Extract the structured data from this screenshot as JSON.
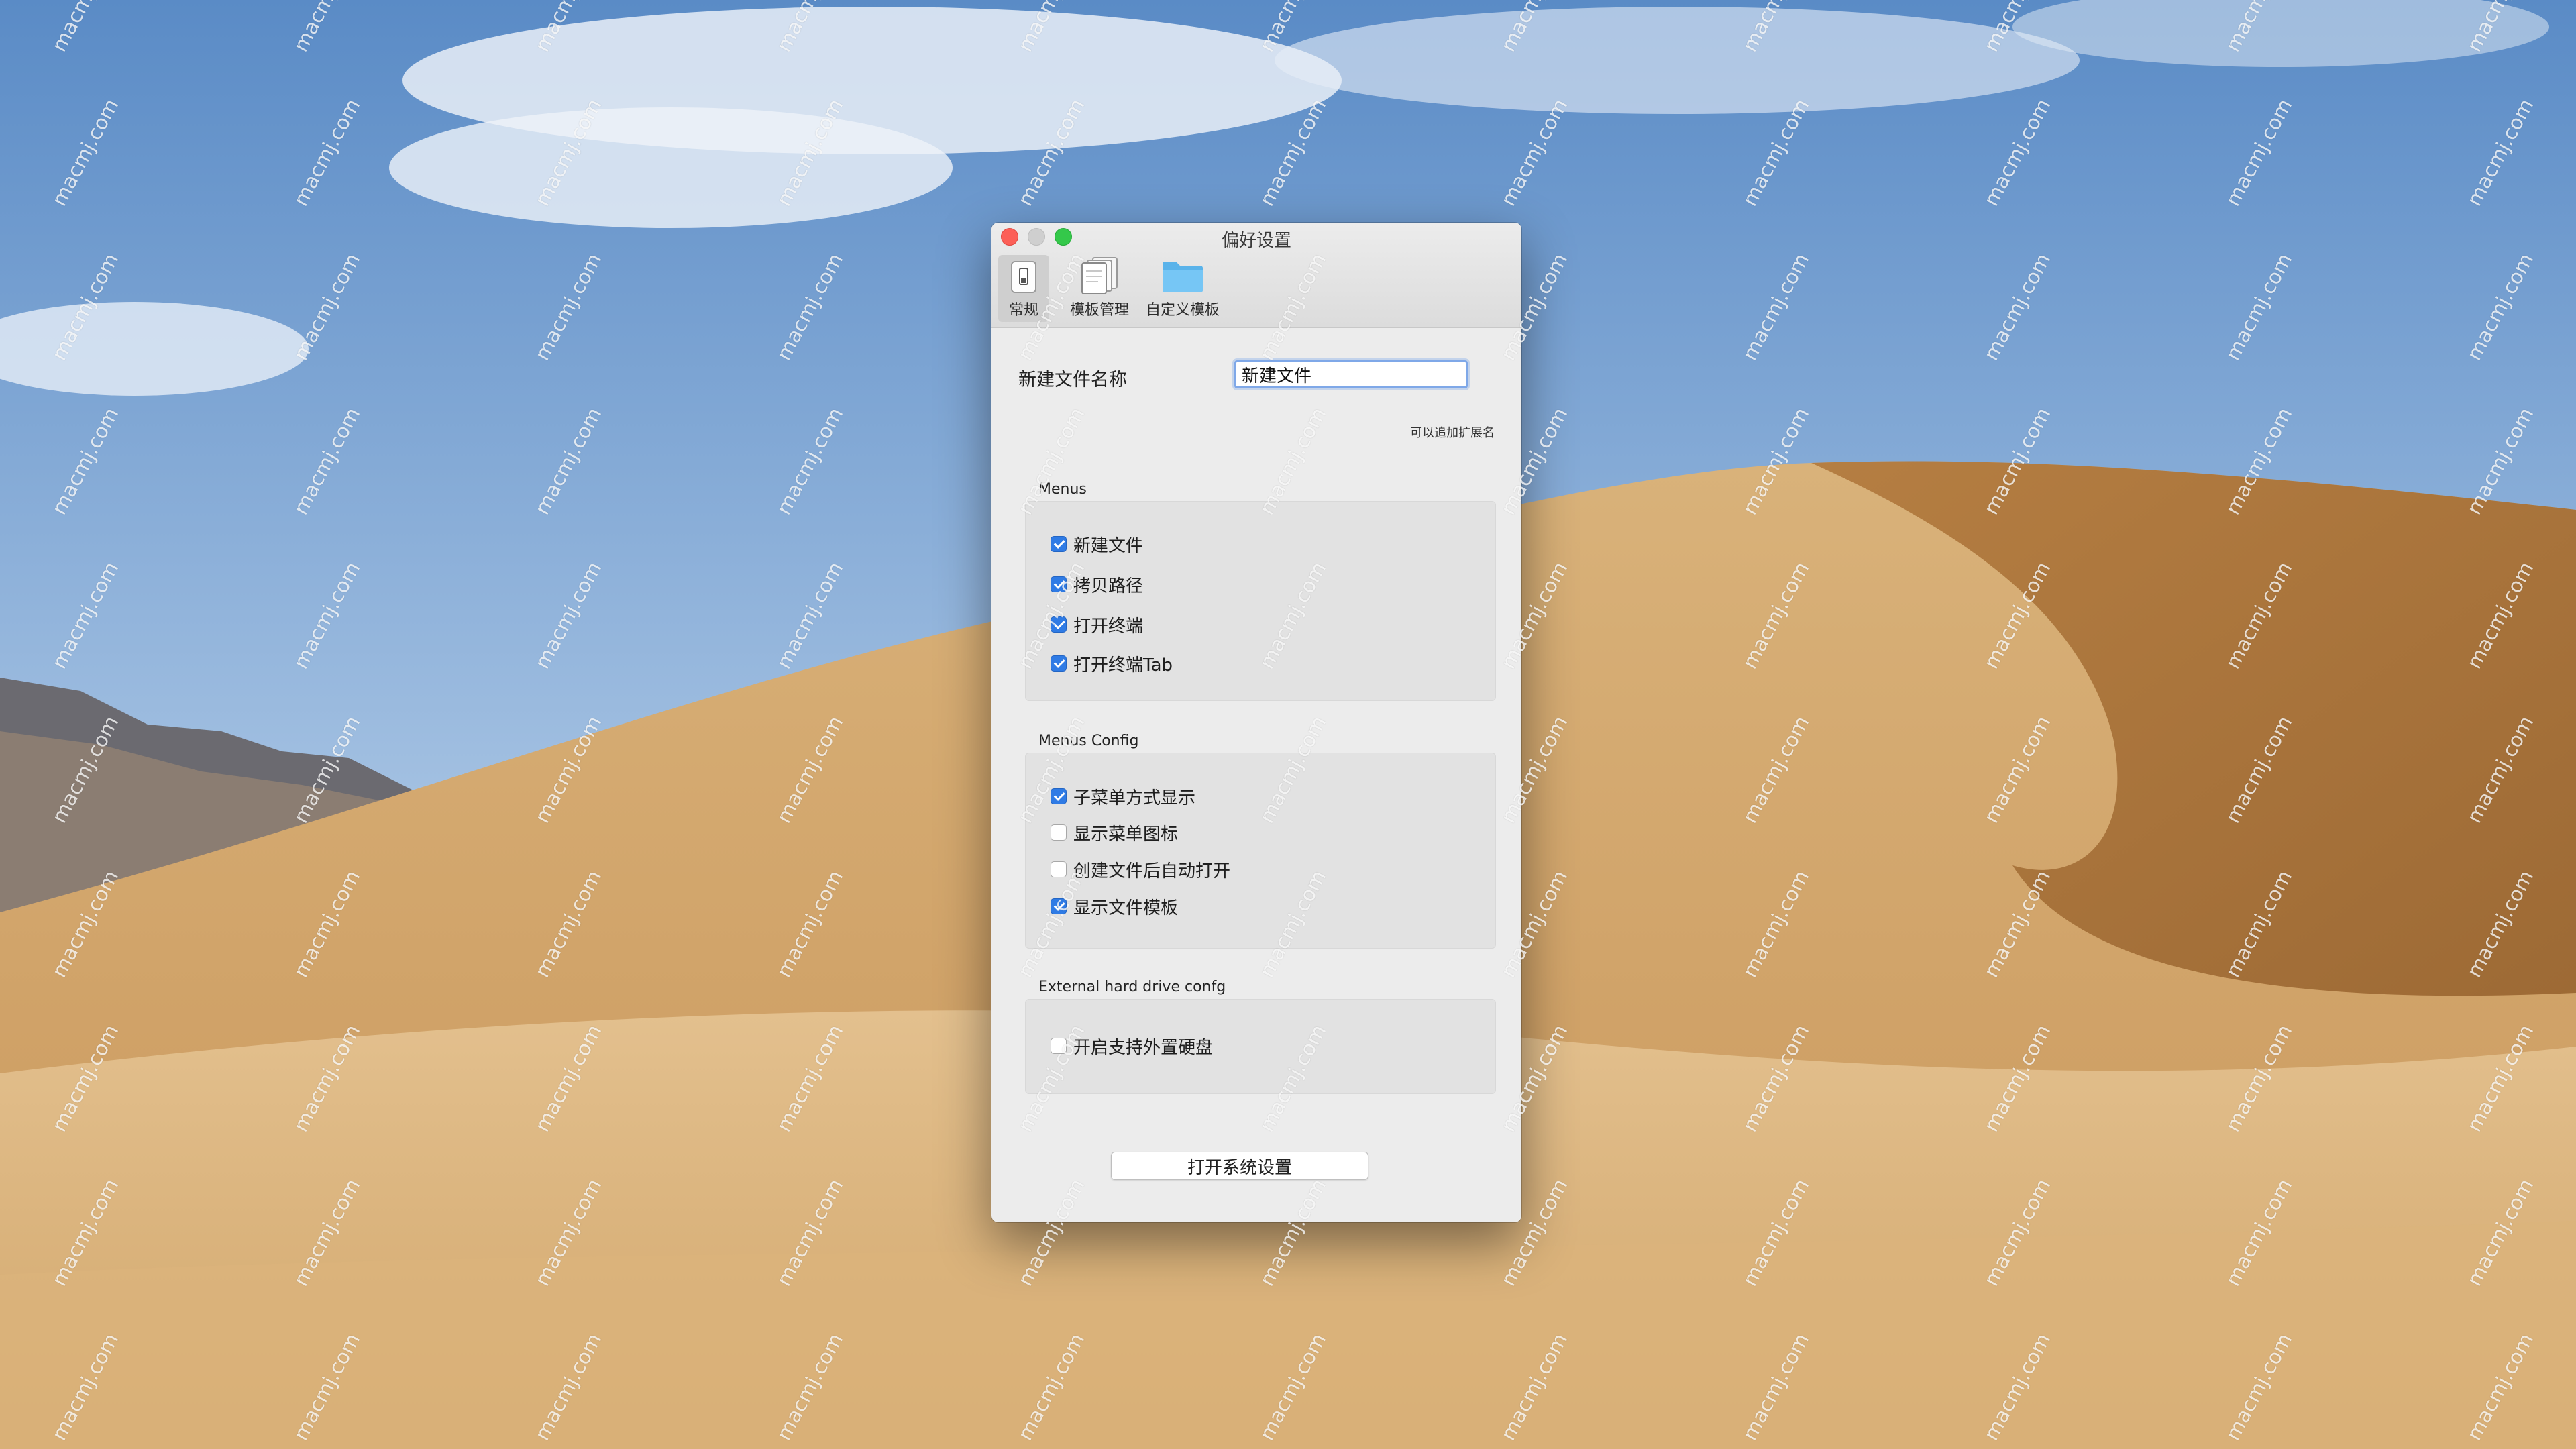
{
  "window": {
    "title": "偏好设置"
  },
  "toolbar": {
    "items": [
      {
        "label": "常规",
        "icon": "switch-icon"
      },
      {
        "label": "模板管理",
        "icon": "documents-icon"
      },
      {
        "label": "自定义模板",
        "icon": "folder-icon"
      }
    ]
  },
  "general": {
    "name_label": "新建文件名称",
    "name_value": "新建文件",
    "name_hint": "可以追加扩展名"
  },
  "menus": {
    "title": "Menus",
    "items": [
      {
        "label": "新建文件",
        "checked": true
      },
      {
        "label": "拷贝路径",
        "checked": true
      },
      {
        "label": "打开终端",
        "checked": true
      },
      {
        "label": "打开终端Tab",
        "checked": true
      }
    ]
  },
  "menus_config": {
    "title": "Menus Config",
    "items": [
      {
        "label": "子菜单方式显示",
        "checked": true
      },
      {
        "label": "显示菜单图标",
        "checked": false
      },
      {
        "label": "创建文件后自动打开",
        "checked": false
      },
      {
        "label": "显示文件模板",
        "checked": true
      }
    ]
  },
  "external": {
    "title": "External hard drive confg",
    "items": [
      {
        "label": "开启支持外置硬盘",
        "checked": false
      }
    ]
  },
  "footer": {
    "open_settings_label": "打开系统设置"
  },
  "watermark": {
    "text": "macmj.com"
  },
  "colors": {
    "accent": "#2f7be5",
    "close": "#fc5f57",
    "maximize": "#34c84a"
  }
}
